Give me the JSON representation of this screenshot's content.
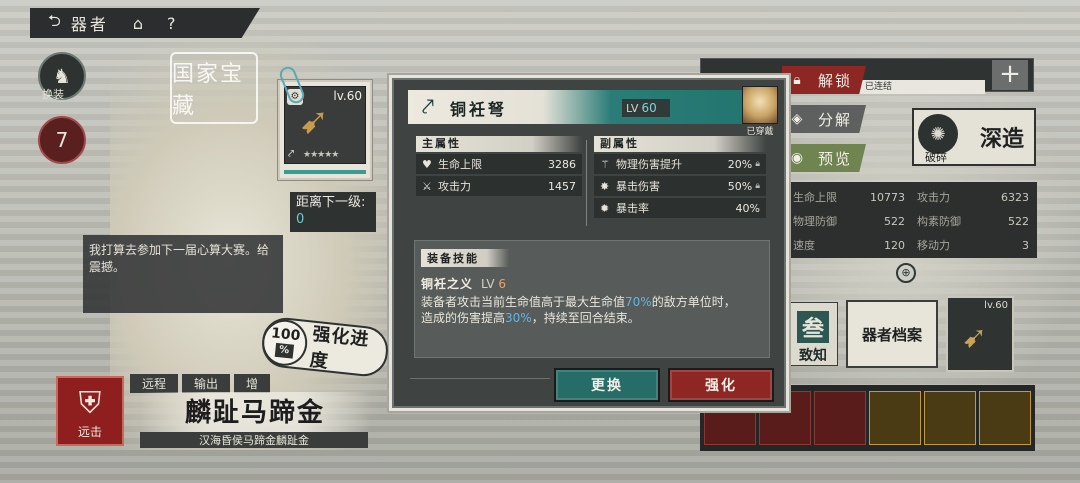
{
  "nav": {
    "title": "器者",
    "back_icon": "back-arrow-icon",
    "home_icon": "home-icon",
    "help_label": "?"
  },
  "side_buttons": {
    "outfit_label": "换装",
    "outfit_icon": "outfit-icon",
    "favor_label": "7",
    "favor_sublabel": "",
    "favor_icon": "heart-icon"
  },
  "logo": {
    "text": "国家宝藏"
  },
  "dialogue": {
    "text": "我打算去参加下一届心算大赛。给震撼。"
  },
  "character": {
    "tags": [
      "远程",
      "输出",
      "增"
    ],
    "name": "麟趾马蹄金",
    "subtitle": "汉海昏侯马蹄金麟趾金",
    "range_label": "远击"
  },
  "weapon_card": {
    "level": "lv.60",
    "stars": "★★★★★",
    "icon": "crossbow-icon"
  },
  "next_level": {
    "label": "距离下一级:",
    "value": "0"
  },
  "enhance_progress": {
    "percent": "100",
    "percent_sign": "%",
    "label": "强化进度"
  },
  "dialog": {
    "weapon_name": "铜衽弩",
    "weapon_icon": "bow-icon",
    "lv_label": "LV",
    "lv_value": "60",
    "worn_label": "已穿戴",
    "main_attr_title": "主属性",
    "sub_attr_title": "副属性",
    "main_attrs": [
      {
        "icon": "heart-icon",
        "name": "生命上限",
        "value": "3286"
      },
      {
        "icon": "crossed-swords-icon",
        "name": "攻击力",
        "value": "1457"
      }
    ],
    "sub_attrs": [
      {
        "icon": "sword-up-icon",
        "name": "物理伤害提升",
        "value": "20%"
      },
      {
        "icon": "crit-damage-icon",
        "name": "暴击伤害",
        "value": "50%"
      },
      {
        "icon": "crit-rate-icon",
        "name": "暴击率",
        "value": "40%"
      }
    ],
    "skill_title": "装备技能",
    "skill_name": "铜衽之义",
    "skill_lv_label": "LV",
    "skill_lv_value": "6",
    "skill_desc_1": "装备者攻击当前生命值高于最大生命值",
    "skill_desc_hl1": "70%",
    "skill_desc_2": "的敌方单位时，",
    "skill_desc_3": "造成的伤害提高",
    "skill_desc_hl2": "30%",
    "skill_desc_4": "，持续至回合结束。",
    "replace_label": "更换",
    "enhance_label": "强化"
  },
  "actions": {
    "unlock_label": "解锁",
    "decompose_label": "分解",
    "preview_label": "预览"
  },
  "right_panel": {
    "deep_label": "深造",
    "deep_sublabel": "破碎",
    "name_strip": "已连结",
    "stats": [
      {
        "name": "生命上限",
        "value": "10773"
      },
      {
        "name": "攻击力",
        "value": "6323"
      },
      {
        "name": "物理防御",
        "value": "522"
      },
      {
        "name": "构素防御",
        "value": "522"
      },
      {
        "name": "速度",
        "value": "120"
      },
      {
        "name": "移动力",
        "value": "3"
      }
    ],
    "sanzhi_big": "叁",
    "sanzhi_small": "致知",
    "archive_label": "器者档案",
    "gear_level": "lv.60",
    "skill_slots": [
      "",
      "",
      "",
      "",
      "",
      ""
    ]
  }
}
